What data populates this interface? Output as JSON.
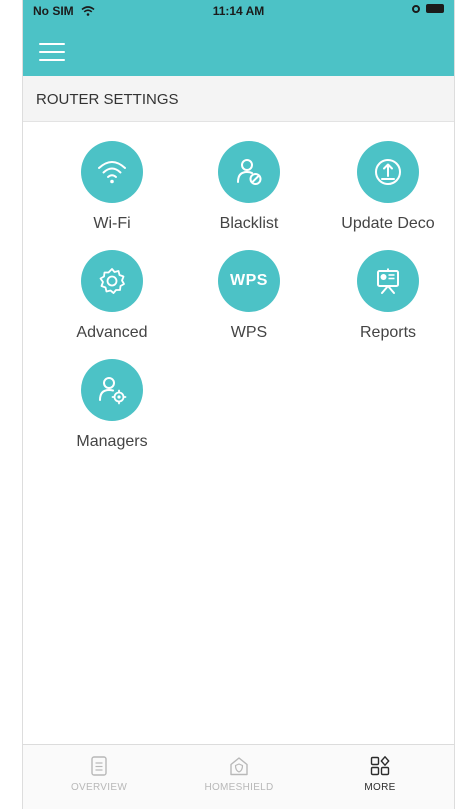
{
  "status_bar": {
    "carrier": "No SIM",
    "time": "11:14 AM"
  },
  "header": {
    "menu_icon": "hamburger-menu-icon"
  },
  "section": {
    "title": "ROUTER SETTINGS"
  },
  "tiles": [
    {
      "label": "Wi-Fi",
      "icon": "wifi-icon"
    },
    {
      "label": "Blacklist",
      "icon": "blacklist-user-icon"
    },
    {
      "label": "Update Deco",
      "icon": "update-icon"
    },
    {
      "label": "Advanced",
      "icon": "gear-icon"
    },
    {
      "label": "WPS",
      "icon": "wps-icon",
      "icon_text": "WPS"
    },
    {
      "label": "Reports",
      "icon": "report-board-icon"
    },
    {
      "label": "Managers",
      "icon": "manager-user-gear-icon"
    }
  ],
  "tabbar": {
    "tabs": [
      {
        "label": "OVERVIEW",
        "icon": "document-icon",
        "active": false
      },
      {
        "label": "HOMESHIELD",
        "icon": "home-shield-icon",
        "active": false
      },
      {
        "label": "MORE",
        "icon": "grid-more-icon",
        "active": true
      }
    ]
  },
  "colors": {
    "accent": "#4cc2c6",
    "active_tab": "#2b2b2b",
    "inactive_tab": "#b8b8b8"
  }
}
